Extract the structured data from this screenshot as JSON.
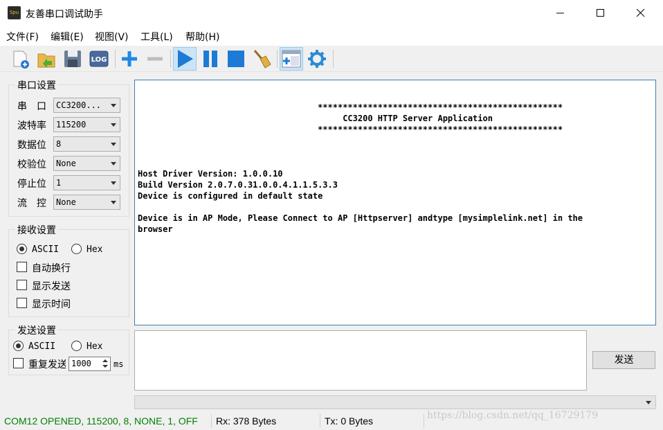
{
  "window": {
    "title": "友善串口调试助手",
    "icon_text": "Sрu"
  },
  "menu": [
    {
      "label": "文件(F)"
    },
    {
      "label": "编辑(E)"
    },
    {
      "label": "视图(V)"
    },
    {
      "label": "工具(L)"
    },
    {
      "label": "帮助(H)"
    }
  ],
  "toolbar": {
    "icons": [
      "new-file-icon",
      "open-folder-icon",
      "save-icon",
      "log-icon",
      "add-icon",
      "remove-icon",
      "play-icon",
      "pause-icon",
      "stop-icon",
      "clear-broom-icon",
      "toggle-send-panel-icon",
      "settings-gear-icon"
    ],
    "log_label": "LOG"
  },
  "serial_settings": {
    "title": "串口设置",
    "port": {
      "label": "串　口",
      "value": "CC3200..."
    },
    "baud": {
      "label": "波特率",
      "value": "115200"
    },
    "data_bits": {
      "label": "数据位",
      "value": "8"
    },
    "parity": {
      "label": "校验位",
      "value": "None"
    },
    "stop_bits": {
      "label": "停止位",
      "value": "1"
    },
    "flow": {
      "label": "流　控",
      "value": "None"
    }
  },
  "receive_settings": {
    "title": "接收设置",
    "ascii_label": "ASCII",
    "hex_label": "Hex",
    "auto_wrap_label": "自动换行",
    "show_send_label": "显示发送",
    "show_time_label": "显示时间"
  },
  "send_settings": {
    "title": "发送设置",
    "ascii_label": "ASCII",
    "hex_label": "Hex",
    "repeat_label": "重复发送",
    "interval_value": "1000",
    "interval_unit": "ms"
  },
  "receive_text": [
    "",
    "                                    *************************************************",
    "                                         CC3200 HTTP Server Application",
    "                                    *************************************************",
    "",
    "",
    "",
    "Host Driver Version: 1.0.0.10",
    "Build Version 2.0.7.0.31.0.0.4.1.1.5.3.3",
    "Device is configured in default state",
    "",
    "Device is in AP Mode, Please Connect to AP [Httpserver] andtype [mysimplelink.net] in the",
    "browser"
  ],
  "send_button": "发送",
  "status": {
    "connection": "COM12 OPENED, 115200, 8, NONE, 1, OFF",
    "rx": "Rx: 378 Bytes",
    "tx": "Tx: 0 Bytes",
    "connection_color": "#008000"
  },
  "watermark": "https://blog.csdn.net/qq_16729179"
}
